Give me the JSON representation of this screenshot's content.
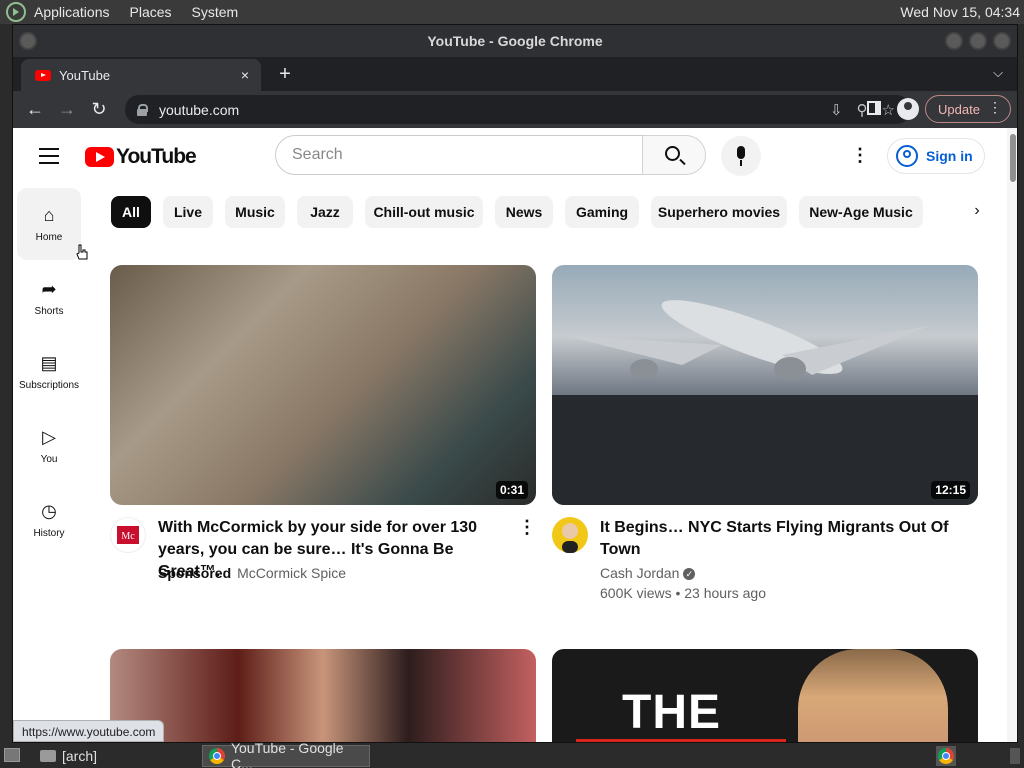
{
  "desktop": {
    "menus": [
      "Applications",
      "Places",
      "System"
    ],
    "clock": "Wed Nov 15, 04:34"
  },
  "window": {
    "title": "YouTube - Google Chrome"
  },
  "tabs": [
    {
      "title": "YouTube",
      "close": "×"
    }
  ],
  "toolbar": {
    "new_tab": "+",
    "url": "youtube.com",
    "update_label": "Update"
  },
  "yt": {
    "logo_text": "YouTube",
    "search_placeholder": "Search",
    "signin_label": "Sign in",
    "guide": [
      {
        "label": "Home",
        "icon": "home-icon",
        "active": true
      },
      {
        "label": "Shorts",
        "icon": "shorts-icon",
        "active": false
      },
      {
        "label": "Subscriptions",
        "icon": "subscriptions-icon",
        "active": false
      },
      {
        "label": "You",
        "icon": "you-icon",
        "active": false
      },
      {
        "label": "History",
        "icon": "history-icon",
        "active": false
      }
    ],
    "chips": [
      "All",
      "Live",
      "Music",
      "Jazz",
      "Chill-out music",
      "News",
      "Gaming",
      "Superhero movies",
      "New-Age Music"
    ],
    "videos": [
      {
        "title": "With McCormick by your side for over 130 years, you can be sure… It's Gonna Be Great™.",
        "duration": "0:31",
        "sponsored": "Sponsored",
        "channel": "McCormick Spice",
        "stats": ""
      },
      {
        "title": "It Begins… NYC Starts Flying Migrants Out Of Town",
        "duration": "12:15",
        "channel": "Cash Jordan",
        "stats": "600K views • 23 hours ago"
      },
      {
        "title": "",
        "duration": ""
      },
      {
        "title": "",
        "duration": "",
        "thumb_text": "THE"
      }
    ],
    "status_url": "https://www.youtube.com"
  },
  "taskbar": {
    "items": [
      "[arch]",
      "YouTube - Google C..."
    ]
  },
  "colors": {
    "brand_red": "#ff0000",
    "link_blue": "#065fd4",
    "chrome_dark": "#35363a"
  }
}
